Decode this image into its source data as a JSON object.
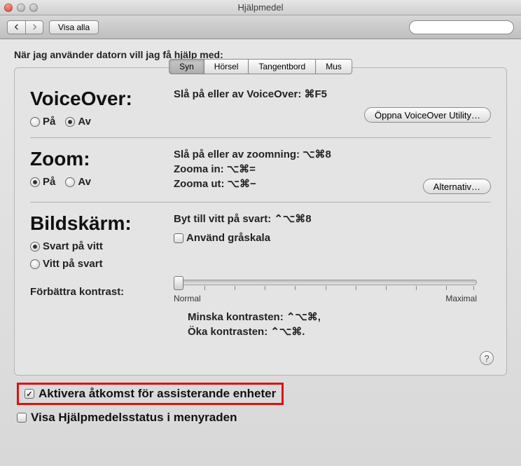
{
  "window": {
    "title": "Hjälpmedel"
  },
  "toolbar": {
    "show_all": "Visa alla",
    "search_placeholder": ""
  },
  "intro": "När jag använder datorn vill jag få hjälp med:",
  "tabs": {
    "items": [
      {
        "label": "Syn",
        "selected": true
      },
      {
        "label": "Hörsel",
        "selected": false
      },
      {
        "label": "Tangentbord",
        "selected": false
      },
      {
        "label": "Mus",
        "selected": false
      }
    ]
  },
  "voiceover": {
    "title": "VoiceOver:",
    "desc": "Slå på eller av VoiceOver: ⌘F5",
    "on_label": "På",
    "off_label": "Av",
    "selected": "off",
    "open_utility": "Öppna VoiceOver Utility…"
  },
  "zoom": {
    "title": "Zoom:",
    "desc1": "Slå på eller av zoomning: ⌥⌘8",
    "desc2": "Zooma in: ⌥⌘=",
    "desc3": "Zooma ut: ⌥⌘−",
    "on_label": "På",
    "off_label": "Av",
    "selected": "on",
    "options_btn": "Alternativ…"
  },
  "display": {
    "title": "Bildskärm:",
    "desc": "Byt till vitt på svart: ⌃⌥⌘8",
    "black_on_white": "Svart på vitt",
    "white_on_black": "Vitt på svart",
    "selected": "bow",
    "grayscale": "Använd gråskala",
    "grayscale_checked": false,
    "contrast_label": "Förbättra kontrast:",
    "slider_min": "Normal",
    "slider_max": "Maximal",
    "reduce": "Minska kontrasten: ⌃⌥⌘,",
    "increase": "Öka kontrasten: ⌃⌥⌘."
  },
  "bottom": {
    "enable_access": "Aktivera åtkomst för assisterande enheter",
    "enable_access_checked": true,
    "menu_status": "Visa Hjälpmedelsstatus i menyraden",
    "menu_status_checked": false
  },
  "help": "?"
}
